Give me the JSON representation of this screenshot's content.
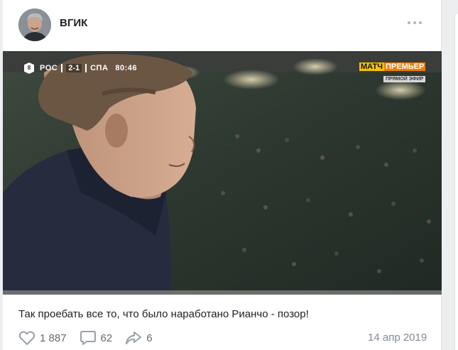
{
  "post": {
    "author": "ВГИК",
    "text": "Так проебать все то, что было наработано Рианчо - позор!",
    "date": "14 апр 2019",
    "likes": "1 887",
    "comments": "62",
    "shares": "6"
  },
  "broadcast": {
    "round": "8",
    "home_team": "РОС",
    "score": "2-1",
    "away_team": "СПА",
    "clock": "80:46",
    "channel_part1": "МАТЧ",
    "channel_part2": "ПРЕМЬЕР",
    "channel_sub": "ПРЯМОЙ ЭФИР"
  },
  "icons": {
    "more": "more-horizontal-icon",
    "like": "heart-icon",
    "comment": "speech-bubble-icon",
    "share": "share-arrow-icon"
  },
  "colors": {
    "icon_gray": "#99a2ad",
    "counter_gray": "#666b70",
    "date_gray": "#828a99",
    "channel_yellow": "#f5c400",
    "channel_orange": "#f07d00"
  }
}
